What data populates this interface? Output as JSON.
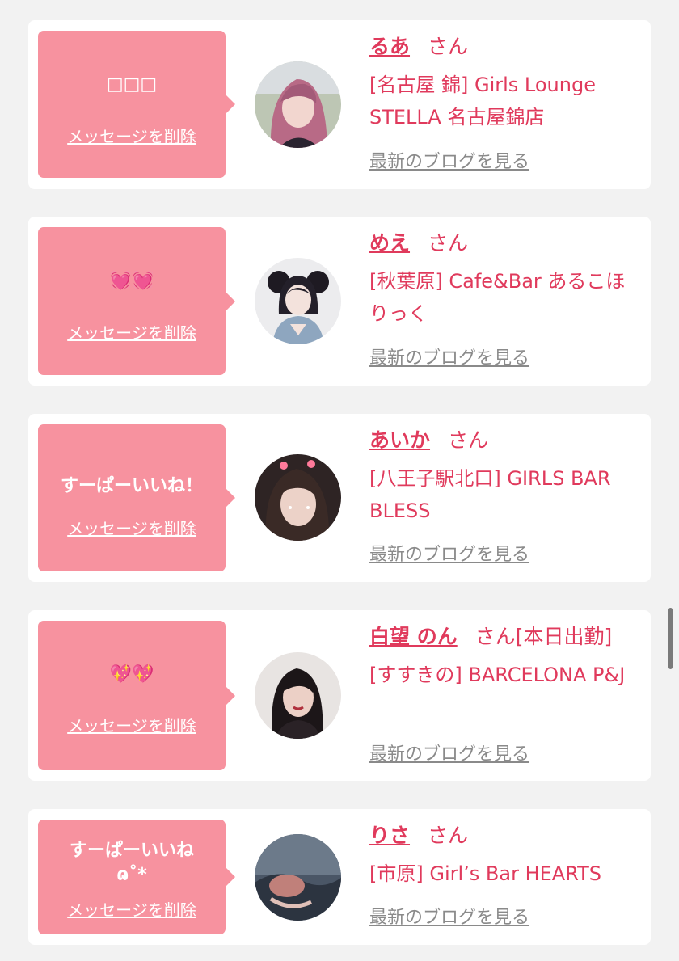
{
  "colors": {
    "page_background": "#f2f2f2",
    "card_background": "#ffffff",
    "bubble_pink": "#f7929f",
    "name_pink": "#e03a5c",
    "blog_link_gray": "#8a8a8a"
  },
  "cards": [
    {
      "message": "□□□",
      "delete_label": "メッセージを削除",
      "avatar_icon": "girl-portrait-pink-hair",
      "name": "るあ",
      "honorific": "さん",
      "badge": "",
      "shop": "[名古屋 錦] Girls Lounge STELLA 名古屋錦店",
      "blog_link": "最新のブログを見る"
    },
    {
      "message": "💓💓",
      "delete_label": "メッセージを削除",
      "avatar_icon": "girl-portrait-maid-outfit",
      "name": "めえ",
      "honorific": "さん",
      "badge": "",
      "shop": "[秋葉原] Cafe&Bar あるこほりっく",
      "blog_link": "最新のブログを見る"
    },
    {
      "message": "すーぱーいいね！",
      "delete_label": "メッセージを削除",
      "avatar_icon": "girl-portrait-selfie-filter",
      "name": "あいか",
      "honorific": "さん",
      "badge": "",
      "shop": "[八王子駅北口] GIRLS BAR BLESS",
      "blog_link": "最新のブログを見る"
    },
    {
      "message": "💖💖",
      "delete_label": "メッセージを削除",
      "avatar_icon": "girl-portrait-dark-hair",
      "name": "白望 のん",
      "honorific": "さん",
      "badge": "[本日出勤]",
      "shop": "[すすきの] BARCELONA P&J",
      "blog_link": "最新のブログを見る"
    },
    {
      "message": "すーぱーいいね\nɷ˚*",
      "delete_label": "メッセージを削除",
      "avatar_icon": "girl-portrait-blurry-night",
      "name": "りさ",
      "honorific": "さん",
      "badge": "",
      "shop": "[市原] Girl’s Bar HEARTS",
      "blog_link": "最新のブログを見る"
    }
  ]
}
